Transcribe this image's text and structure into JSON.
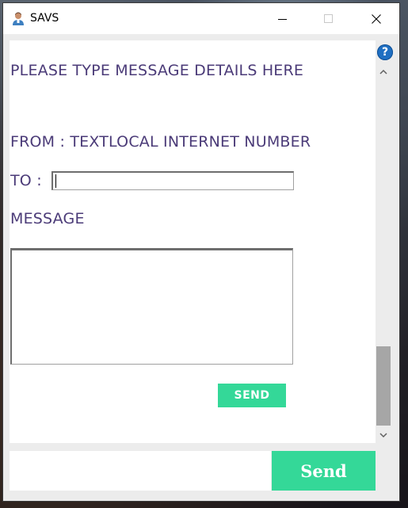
{
  "window": {
    "title": "SAVS",
    "app_icon": "user-avatar-icon",
    "controls": [
      "minimize-icon",
      "maximize-icon",
      "close-icon"
    ]
  },
  "form": {
    "heading": "PLEASE TYPE MESSAGE DETAILS HERE",
    "from_label": "FROM : TEXTLOCAL INTERNET NUMBER",
    "to_label": "TO :",
    "to_value": "",
    "message_label": "MESSAGE",
    "message_value": "",
    "send_label": "SEND"
  },
  "sidebar": {
    "help_icon": "help-icon",
    "help_glyph": "?"
  },
  "footer": {
    "input_value": "",
    "send_label": "Send"
  },
  "colors": {
    "label": "#4b3b78",
    "accent_green": "#34d898",
    "help_blue": "#1f6fc2",
    "scroll_thumb": "#a6a6a6"
  }
}
